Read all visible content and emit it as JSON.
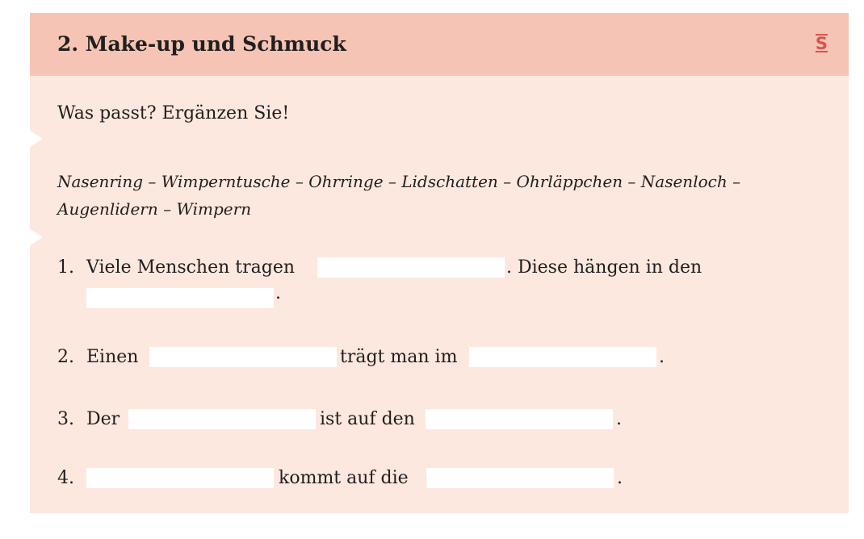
{
  "exercise": {
    "title": "2.  Make-up und Schmuck",
    "logo_text": "S",
    "instruction": "Was passt? Ergänzen Sie!",
    "word_bank": "Nasenring – Wimperntusche – Ohrringe – Lidschatten – Ohrläppchen – Nasenloch – Augenlidern – Wimpern",
    "sentences": [
      {
        "number": "1.",
        "part1": "Viele Menschen tragen",
        "part2": ". Diese hängen in den",
        "part3": "."
      },
      {
        "number": "2.",
        "part1": "Einen",
        "part2": "trägt man im",
        "part3": "."
      },
      {
        "number": "3.",
        "part1": "Der",
        "part2": "ist auf den",
        "part3": "."
      },
      {
        "number": "4.",
        "part2": "kommt auf die",
        "part3": "."
      }
    ]
  },
  "colors": {
    "header_bg": "#f6c4b4",
    "card_bg": "#fde8df",
    "logo_red": "#d9534f"
  }
}
